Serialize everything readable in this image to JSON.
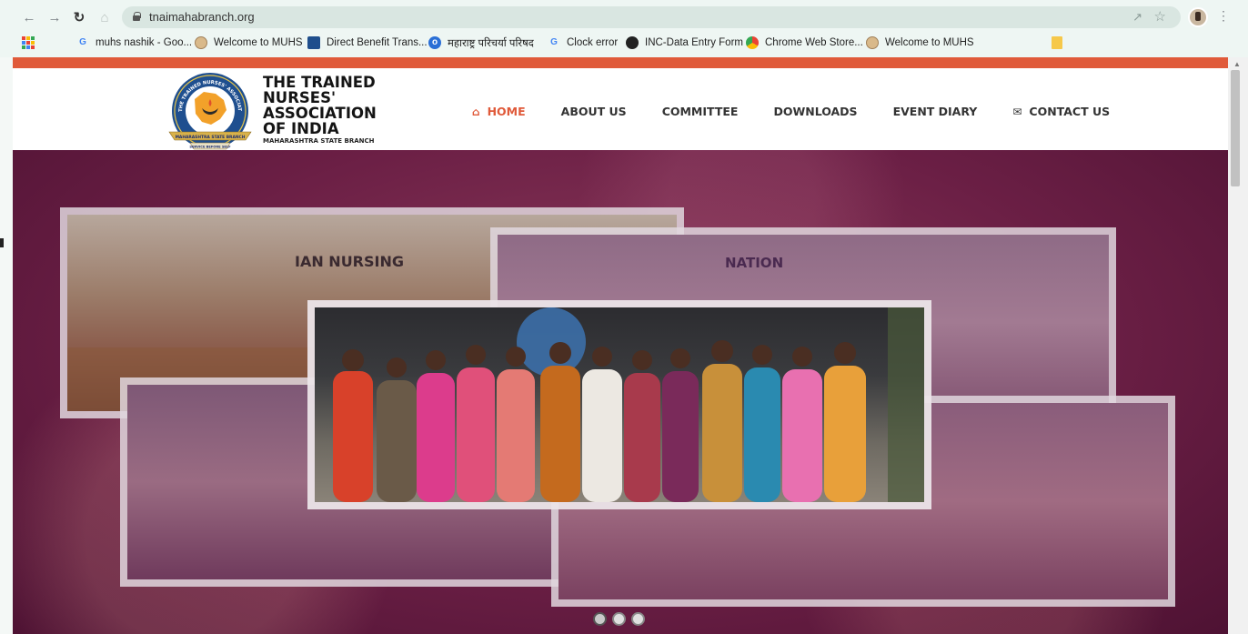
{
  "browser": {
    "url": "tnaimahabranch.org",
    "bookmarks": [
      {
        "label": "muhs nashik - Goo...",
        "icon": "google-icon"
      },
      {
        "label": "Welcome to MUHS",
        "icon": "muhs-icon"
      },
      {
        "label": "Direct Benefit Trans...",
        "icon": "dbt-icon"
      },
      {
        "label": "महाराष्ट्र परिचर्या परिषद",
        "icon": "mnc-icon"
      },
      {
        "label": "Clock error",
        "icon": "google-icon"
      },
      {
        "label": "INC-Data Entry Form",
        "icon": "globe-icon"
      },
      {
        "label": "Chrome Web Store...",
        "icon": "chrome-web-store-icon"
      },
      {
        "label": "Welcome to MUHS",
        "icon": "muhs-icon"
      }
    ]
  },
  "site": {
    "brand": {
      "line1": "THE TRAINED",
      "line2": "NURSES'",
      "line3": "ASSOCIATION",
      "line4": "OF INDIA",
      "sub": "MAHARASHTRA STATE BRANCH"
    },
    "logo": {
      "ring_text": "THE TRAINED NURSES' ASSOCIATION OF INDIA",
      "banner_text": "MAHARASHTRA STATE BRANCH",
      "motto": "SERVICE BEFORE SELF"
    },
    "menu": [
      {
        "label": "HOME",
        "icon": "home-icon",
        "active": true
      },
      {
        "label": "ABOUT US",
        "active": false
      },
      {
        "label": "COMMITTEE",
        "active": false
      },
      {
        "label": "DOWNLOADS",
        "active": false
      },
      {
        "label": "EVENT DIARY",
        "active": false
      },
      {
        "label": "CONTACT US",
        "icon": "envelope-icon",
        "active": false
      }
    ],
    "slider": {
      "slide_count": 3,
      "active_slide": 1,
      "photo_texts": [
        "IAN NURSING",
        "NATION"
      ]
    }
  },
  "colors": {
    "accent": "#e05a3a",
    "hero_bg": "#6b1f45"
  }
}
